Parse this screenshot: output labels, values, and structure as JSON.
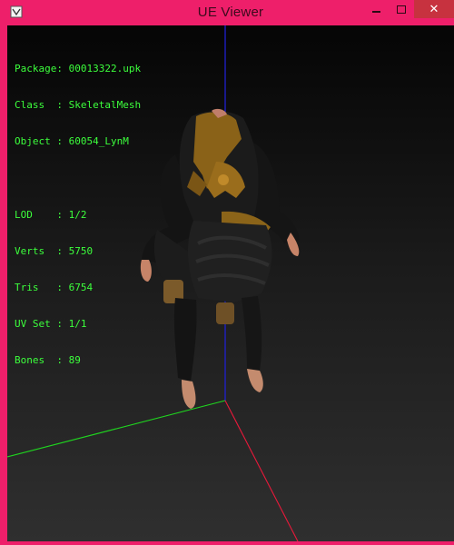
{
  "window": {
    "title": "UE Viewer",
    "frame_color": "#ee1f6a",
    "close_button_color": "#c7323f",
    "controls": {
      "minimize_icon": "minimize-icon",
      "maximize_icon": "maximize-icon",
      "close_icon": "close-icon"
    }
  },
  "info_overlay": {
    "text_color": "#3cff3c",
    "package": {
      "label": "Package:",
      "value": "00013322.upk"
    },
    "class": {
      "label": "Class  :",
      "value": "SkeletalMesh"
    },
    "object": {
      "label": "Object :",
      "value": "60054_LynM"
    },
    "lod": {
      "label": "LOD    :",
      "value": "1/2"
    },
    "verts": {
      "label": "Verts  :",
      "value": "5750"
    },
    "tris": {
      "label": "Tris   :",
      "value": "6754"
    },
    "uvset": {
      "label": "UV Set :",
      "value": "1/1"
    },
    "bones": {
      "label": "Bones  :",
      "value": "89"
    }
  },
  "axes": {
    "x_color": "#e8193a",
    "y_color": "#1fd61f",
    "z_color": "#2020d0"
  }
}
